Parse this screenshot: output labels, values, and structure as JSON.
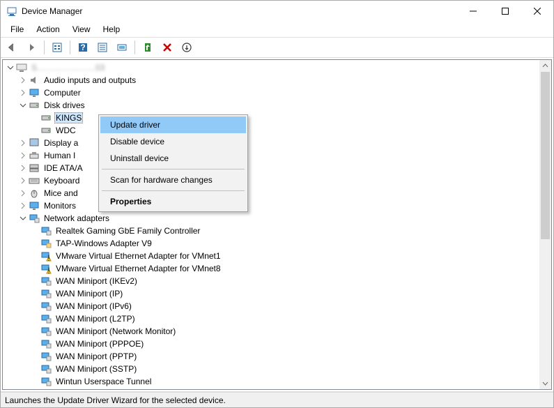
{
  "window": {
    "title": "Device Manager"
  },
  "menu": {
    "file": "File",
    "action": "Action",
    "view": "View",
    "help": "Help"
  },
  "tree": {
    "root": "S…………………03",
    "items": {
      "audio": "Audio inputs and outputs",
      "computer": "Computer",
      "disk": "Disk drives",
      "disk_kings": "KINGS",
      "disk_wdc": "WDC",
      "display": "Display a",
      "hid": "Human I",
      "ide": "IDE ATA/A",
      "keyboard": "Keyboard",
      "mice": "Mice and",
      "monitors": "Monitors",
      "net": "Network adapters",
      "net_realtek": "Realtek Gaming GbE Family Controller",
      "net_tap": "TAP-Windows Adapter V9",
      "net_vmnet1": "VMware Virtual Ethernet Adapter for VMnet1",
      "net_vmnet8": "VMware Virtual Ethernet Adapter for VMnet8",
      "net_ikev2": "WAN Miniport (IKEv2)",
      "net_ip": "WAN Miniport (IP)",
      "net_ipv6": "WAN Miniport (IPv6)",
      "net_l2tp": "WAN Miniport (L2TP)",
      "net_nm": "WAN Miniport (Network Monitor)",
      "net_pppoe": "WAN Miniport (PPPOE)",
      "net_pptp": "WAN Miniport (PPTP)",
      "net_sstp": "WAN Miniport (SSTP)",
      "net_wintun": "Wintun Userspace Tunnel"
    }
  },
  "context": {
    "update": "Update driver",
    "disable": "Disable device",
    "uninstall": "Uninstall device",
    "scan": "Scan for hardware changes",
    "properties": "Properties"
  },
  "status": {
    "text": "Launches the Update Driver Wizard for the selected device."
  }
}
